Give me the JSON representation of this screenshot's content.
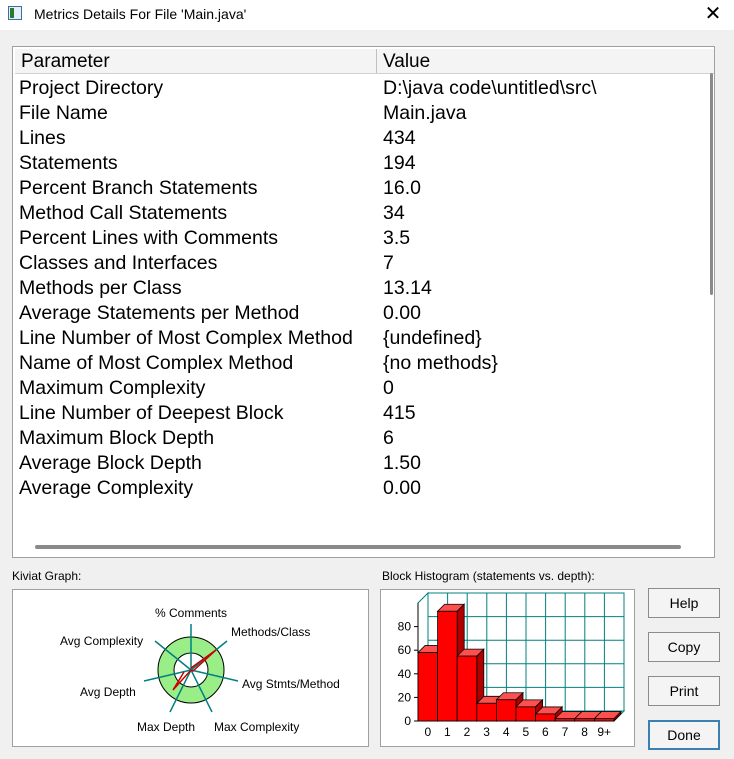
{
  "window": {
    "title": "Metrics Details For File 'Main.java'"
  },
  "table": {
    "headers": {
      "parameter": "Parameter",
      "value": "Value"
    },
    "rows": [
      {
        "parameter": "Project Directory",
        "value": "D:\\java code\\untitled\\src\\"
      },
      {
        "parameter": "File Name",
        "value": "Main.java"
      },
      {
        "parameter": "Lines",
        "value": "434"
      },
      {
        "parameter": "Statements",
        "value": "194"
      },
      {
        "parameter": "Percent Branch Statements",
        "value": "16.0"
      },
      {
        "parameter": "Method Call Statements",
        "value": "34"
      },
      {
        "parameter": "Percent Lines with Comments",
        "value": "3.5"
      },
      {
        "parameter": "Classes and Interfaces",
        "value": "7"
      },
      {
        "parameter": "Methods per Class",
        "value": "13.14"
      },
      {
        "parameter": "Average Statements per Method",
        "value": "0.00"
      },
      {
        "parameter": "Line Number of Most Complex Method",
        "value": "{undefined}"
      },
      {
        "parameter": "Name of Most Complex Method",
        "value": "{no methods}"
      },
      {
        "parameter": "Maximum Complexity",
        "value": "0"
      },
      {
        "parameter": "Line Number of Deepest Block",
        "value": "415"
      },
      {
        "parameter": "Maximum Block Depth",
        "value": "6"
      },
      {
        "parameter": "Average Block Depth",
        "value": "1.50"
      },
      {
        "parameter": "Average Complexity",
        "value": "0.00"
      }
    ]
  },
  "kiviat": {
    "label": "Kiviat Graph:",
    "axes": {
      "comments": "% Comments",
      "methods_class": "Methods/Class",
      "avg_stmts": "Avg Stmts/Method",
      "max_complexity": "Max Complexity",
      "max_depth": "Max Depth",
      "avg_depth": "Avg Depth",
      "avg_complexity": "Avg Complexity"
    },
    "ring_color": "#99ee88",
    "marker_color": "#cc0000"
  },
  "histogram": {
    "label": "Block Histogram (statements vs. depth):",
    "bar_color": "#ff0000",
    "grid_color": "#008080"
  },
  "buttons": {
    "help": "Help",
    "copy": "Copy",
    "print": "Print",
    "done": "Done"
  },
  "chart_data": {
    "type": "bar",
    "title": "Block Histogram (statements vs. depth):",
    "categories": [
      "0",
      "1",
      "2",
      "3",
      "4",
      "5",
      "6",
      "7",
      "8",
      "9+"
    ],
    "values": [
      58,
      93,
      55,
      15,
      18,
      12,
      6,
      2,
      2,
      2
    ],
    "ylim": [
      0,
      100
    ],
    "yticks": [
      "0",
      "20",
      "40",
      "60",
      "80"
    ],
    "grid": true
  }
}
